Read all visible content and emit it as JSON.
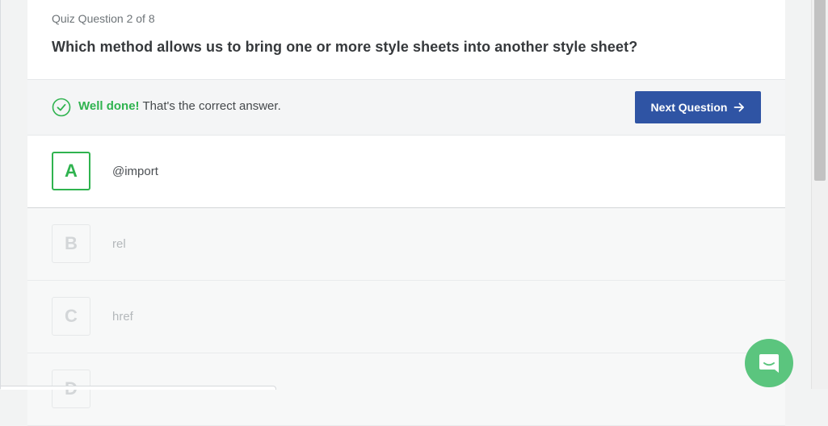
{
  "quiz": {
    "progress": "Quiz Question 2 of 8",
    "question": "Which method allows us to bring one or more style sheets into another style sheet?"
  },
  "feedback": {
    "icon": "check-circle-icon",
    "status": "Well done!",
    "message": "That's the correct answer.",
    "status_color": "#2fb34f"
  },
  "next_button": {
    "label": "Next Question",
    "icon": "arrow-right-icon",
    "color": "#2f54a4"
  },
  "options": [
    {
      "letter": "A",
      "text": "@import",
      "state": "correct"
    },
    {
      "letter": "B",
      "text": "rel",
      "state": "dimmed"
    },
    {
      "letter": "C",
      "text": "href",
      "state": "dimmed"
    },
    {
      "letter": "D",
      "text": "",
      "state": "dimmed"
    }
  ],
  "chat": {
    "icon": "chat-bubble-icon",
    "color": "#5bc57e"
  }
}
